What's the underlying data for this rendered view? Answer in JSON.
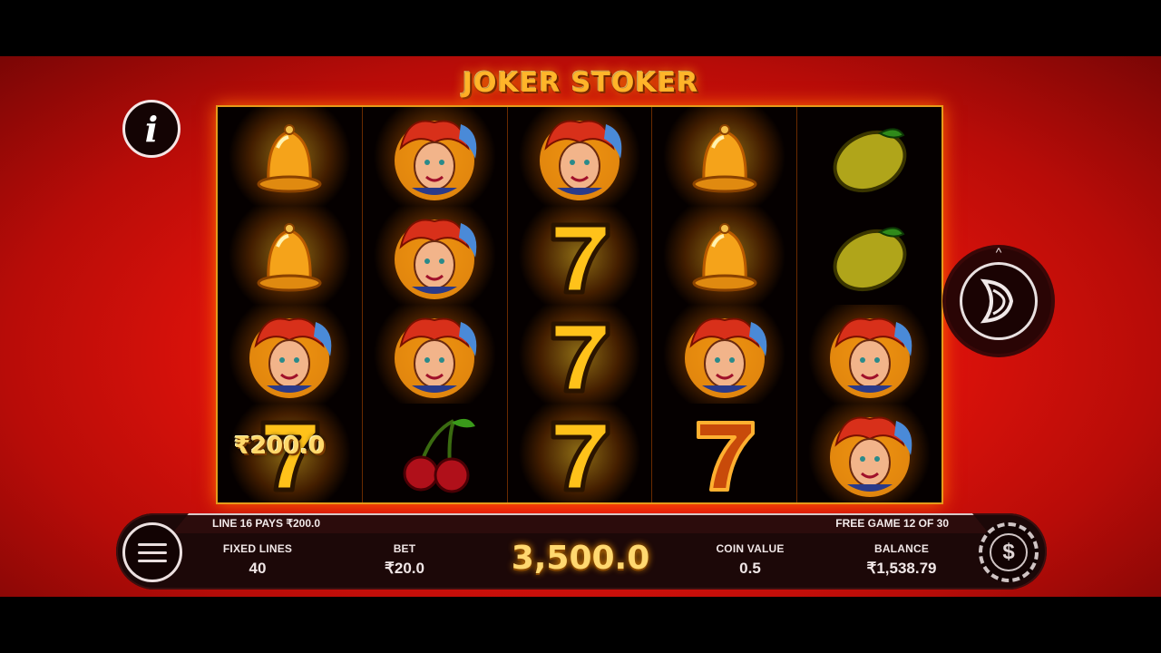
{
  "game": {
    "title": "JOKER STOKER"
  },
  "buttons": {
    "info_glyph": "i",
    "coin_glyph": "$",
    "spin_chevron": "^"
  },
  "reels": [
    [
      "bell",
      "bell",
      "joker",
      "seven-gold"
    ],
    [
      "joker",
      "joker",
      "joker",
      "cherry"
    ],
    [
      "joker",
      "seven-gold",
      "seven-gold",
      "seven-gold"
    ],
    [
      "bell",
      "bell",
      "joker",
      "seven-red"
    ],
    [
      "lemon",
      "lemon",
      "joker",
      "joker"
    ]
  ],
  "win_overlay": {
    "label": "₹200.0"
  },
  "hud": {
    "line_pays": "LINE 16 PAYS ₹200.0",
    "free_game": "FREE GAME 12 OF 30",
    "fixed_lines": {
      "label": "FIXED LINES",
      "value": "40"
    },
    "bet": {
      "label": "BET",
      "value": "₹20.0"
    },
    "win": "3,500.0",
    "coin_value": {
      "label": "COIN VALUE",
      "value": "0.5"
    },
    "balance": {
      "label": "BALANCE",
      "value": "₹1,538.79"
    }
  },
  "colors": {
    "background": "#e8140c",
    "gold": "#ffb52a",
    "frame": "#e59a1a",
    "hud": "#1c0808"
  }
}
